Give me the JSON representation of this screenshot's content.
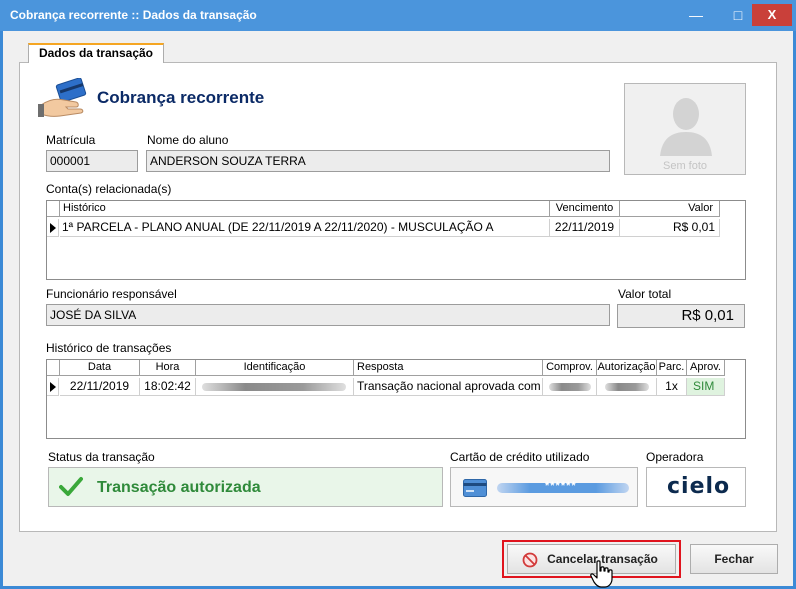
{
  "window": {
    "title": "Cobrança recorrente :: Dados da transação",
    "minimize": "—",
    "maximize": "□",
    "close": "X"
  },
  "tab": {
    "label": "Dados da transação"
  },
  "header": {
    "title": "Cobrança recorrente"
  },
  "photo": {
    "caption": "Sem foto"
  },
  "matricula": {
    "label": "Matrícula",
    "value": "000001"
  },
  "aluno": {
    "label": "Nome do aluno",
    "value": "ANDERSON SOUZA TERRA"
  },
  "contas": {
    "label": "Conta(s) relacionada(s)",
    "columns": [
      "Histórico",
      "Vencimento",
      "Valor"
    ],
    "rows": [
      {
        "historico": "1ª PARCELA - PLANO ANUAL (DE 22/11/2019 A 22/11/2020) - MUSCULAÇÃO A",
        "vencimento": "22/11/2019",
        "valor": "R$ 0,01"
      }
    ]
  },
  "funcionario": {
    "label": "Funcionário responsável",
    "value": "JOSÉ DA SILVA"
  },
  "total": {
    "label": "Valor total",
    "value": "R$ 0,01"
  },
  "transacoes": {
    "label": "Histórico de transações",
    "columns": [
      "Data",
      "Hora",
      "Identificação",
      "Resposta",
      "Comprov.",
      "Autorização",
      "Parc.",
      "Aprov."
    ],
    "rows": [
      {
        "data": "22/11/2019",
        "hora": "18:02:42",
        "resposta": "Transação nacional aprovada com",
        "parc": "1x",
        "aprov": "SIM"
      }
    ]
  },
  "status": {
    "label": "Status da transação",
    "value": "Transação autorizada"
  },
  "cartao": {
    "label": "Cartão de crédito utilizado",
    "masked": "******"
  },
  "operadora": {
    "label": "Operadora",
    "logo_text": "cielo"
  },
  "buttons": {
    "cancel": "Cancelar transação",
    "close": "Fechar"
  },
  "colors": {
    "titlebar": "#4b95dc",
    "close_red": "#c9403a",
    "header_title": "#0b2a66",
    "status_green": "#2f8a3a",
    "status_bg": "#e9f6e9",
    "sim_bg": "#dff3df",
    "highlight_red": "#e0141e",
    "tab_accent": "#f5a623"
  },
  "icons": [
    "hand-card-icon",
    "avatar-placeholder-icon",
    "checkmark-icon",
    "credit-card-icon",
    "cancel-icon",
    "hand-pointer-icon",
    "cielo-logo"
  ]
}
